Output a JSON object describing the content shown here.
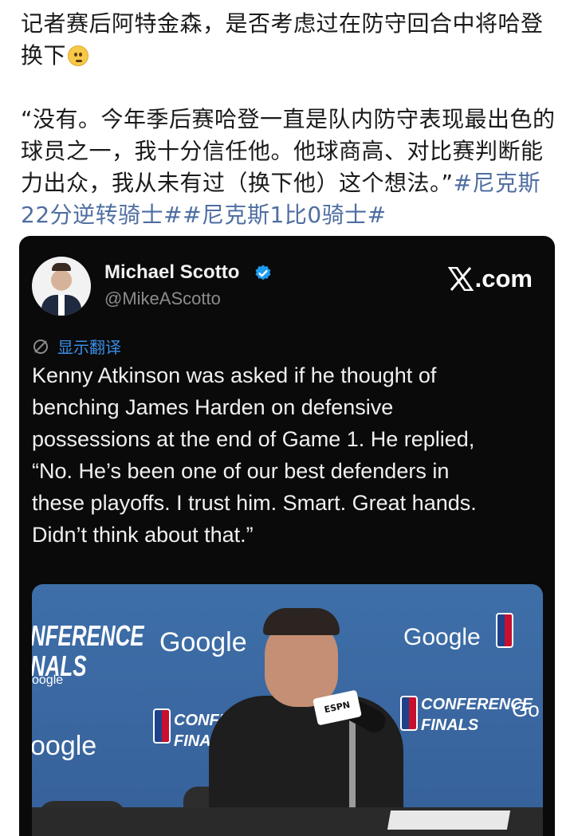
{
  "post": {
    "question": "记者赛后阿特金森，是否考虑过在防守回合中将哈登换下",
    "answer": "“没有。今年季后赛哈登一直是队内防守表现最出色的球员之一，我十分信任他。他球商高、对比赛判断能力出众，我从未有过（换下他）这个想法。”",
    "hashtags": "#尼克斯22分逆转骑士##尼克斯1比0骑士#"
  },
  "tweet": {
    "author_name": "Michael Scotto",
    "handle": "@MikeAScotto",
    "brand": ".com",
    "translate_label": "显示翻译",
    "text": "Kenny Atkinson was asked if he thought of\nbenching James Harden on defensive\npossessions at the end of Game 1. He replied,\n“No. He’s been one of our best defenders in\nthese playoffs. I trust him. Smart. Great hands.\nDidn’t think about that.”"
  },
  "media_backdrop": {
    "google": "Google",
    "partial_google": "oogle",
    "conference": "CONFERENCE",
    "finals": "FINALS",
    "left_conf": "NFERENCE",
    "left_finals": "NALS",
    "left_small": "oogle",
    "mic_flag": "ESPN"
  },
  "colors": {
    "hashtag": "#4e6ea1",
    "card_bg": "#0a0a0a",
    "translate": "#3a8ee6",
    "verified": "#1d9bf0",
    "backdrop": "#3e6fa8"
  },
  "icons": [
    "emoji-thinking-icon",
    "verified-badge-icon",
    "x-logo-icon",
    "translate-icon"
  ]
}
